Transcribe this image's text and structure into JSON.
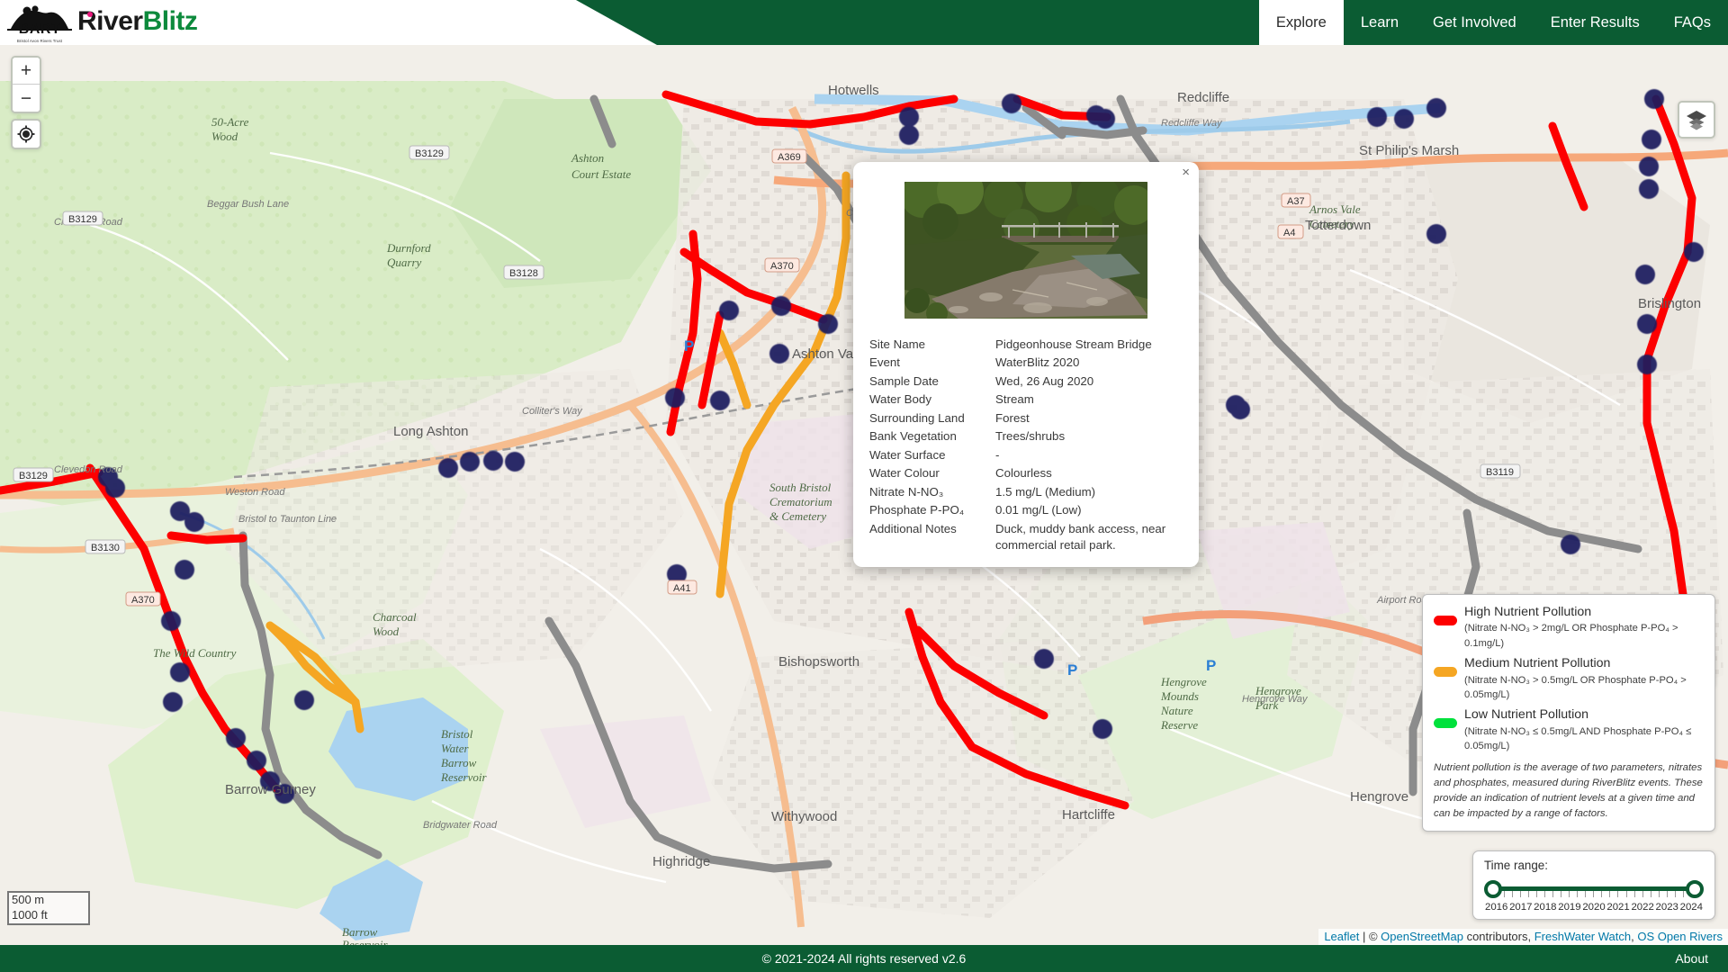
{
  "header": {
    "logo": {
      "org_abbr": "BART",
      "org_full": "Bristol Avon Rivers Trust",
      "brand_part1": "R",
      "brand_part2": "iver",
      "brand_part3": "Blitz"
    },
    "nav": [
      {
        "label": "Explore",
        "active": true
      },
      {
        "label": "Learn",
        "active": false
      },
      {
        "label": "Get Involved",
        "active": false
      },
      {
        "label": "Enter Results",
        "active": false
      },
      {
        "label": "FAQs",
        "active": false
      }
    ]
  },
  "map_controls": {
    "zoom_in": "+",
    "zoom_out": "−",
    "scale_metric": "500 m",
    "scale_imperial": "1000 ft"
  },
  "popup": {
    "close": "×",
    "rows": [
      {
        "key": "Site Name",
        "value": "Pidgeonhouse Stream Bridge"
      },
      {
        "key": "Event",
        "value": "WaterBlitz 2020"
      },
      {
        "key": "Sample Date",
        "value": "Wed, 26 Aug 2020"
      },
      {
        "key": "Water Body",
        "value": "Stream"
      },
      {
        "key": "Surrounding Land",
        "value": "Forest"
      },
      {
        "key": "Bank Vegetation",
        "value": "Trees/shrubs"
      },
      {
        "key": "Water Surface",
        "value": "-"
      },
      {
        "key": "Water Colour",
        "value": "Colourless"
      },
      {
        "key": "Nitrate N-NO₃",
        "value": "1.5 mg/L (Medium)"
      },
      {
        "key": "Phosphate P-PO₄",
        "value": "0.01 mg/L (Low)"
      },
      {
        "key": "Additional Notes",
        "value": "Duck, muddy bank access, near commercial retail park."
      }
    ]
  },
  "legend": {
    "items": [
      {
        "color": "#fd0000",
        "title": "High Nutrient Pollution",
        "subtitle": "(Nitrate N-NO₃ > 2mg/L OR Phosphate P-PO₄ > 0.1mg/L)"
      },
      {
        "color": "#f5a623",
        "title": "Medium Nutrient Pollution",
        "subtitle": "(Nitrate N-NO₃ > 0.5mg/L OR Phosphate P-PO₄ > 0.05mg/L)"
      },
      {
        "color": "#00e13c",
        "title": "Low Nutrient Pollution",
        "subtitle": "(Nitrate N-NO₃ ≤ 0.5mg/L AND Phosphate P-PO₄ ≤ 0.05mg/L)"
      }
    ],
    "note": "Nutrient pollution is the average of two parameters, nitrates and phosphates, measured during RiverBlitz events. These provide an indication of nutrient levels at a given time and can be impacted by a range of factors."
  },
  "timerange": {
    "label": "Time range:",
    "years": [
      "2016",
      "2017",
      "2018",
      "2019",
      "2020",
      "2021",
      "2022",
      "2023",
      "2024"
    ],
    "selected_start": "2016",
    "selected_end": "2024",
    "accent": "#0b5c33"
  },
  "attribution": {
    "leaflet": "Leaflet",
    "sep1": " | ",
    "copyright": "© ",
    "osm": "OpenStreetMap",
    "contributors": " contributors, ",
    "fww": "FreshWater Watch",
    "comma": ", ",
    "osrivers": "OS Open Rivers"
  },
  "footer": {
    "copyright": "© 2021-2024 All rights reserved v2.6",
    "about": "About"
  },
  "colors": {
    "brand_green": "#0b5c33",
    "accent_pink": "#e8197d",
    "marker_navy": "#1a1a5e",
    "high": "#fd0000",
    "medium": "#f5a623",
    "low": "#00e13c"
  }
}
